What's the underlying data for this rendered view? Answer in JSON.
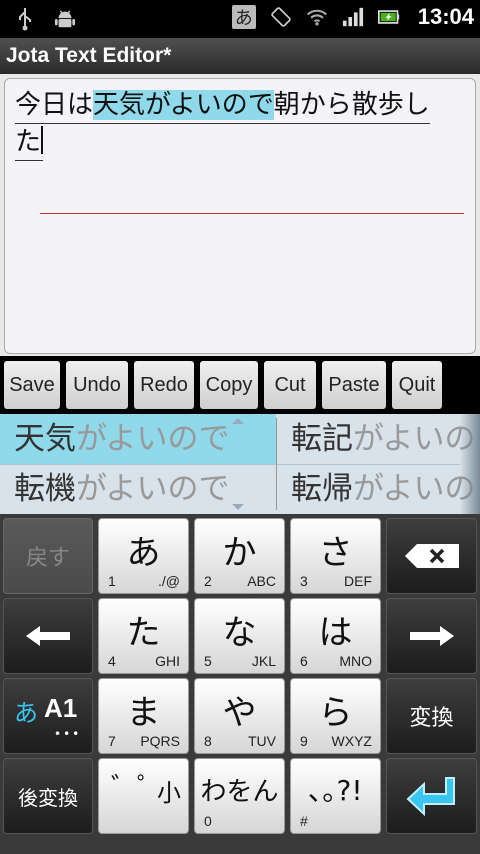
{
  "statusbar": {
    "ime_indicator": "あ",
    "time": "13:04",
    "icons": [
      "usb-icon",
      "android-debug-icon",
      "ime-icon",
      "rotation-icon",
      "wifi-icon",
      "signal-icon",
      "battery-icon"
    ]
  },
  "app": {
    "title": "Jota Text Editor*"
  },
  "editor": {
    "line1_before": "今日は",
    "line1_highlight": "天気がよいので",
    "line1_after": "朝から散歩し",
    "line2": "た"
  },
  "toolbar": {
    "save": "Save",
    "undo": "Undo",
    "redo": "Redo",
    "copy": "Copy",
    "cut": "Cut",
    "paste": "Paste",
    "quit": "Quit"
  },
  "candidates": [
    {
      "kanji": "天気",
      "kana": "がよいので"
    },
    {
      "kanji": "転記",
      "kana": "がよいので"
    },
    {
      "kanji": "転機",
      "kana": "がよいので"
    },
    {
      "kanji": "転帰",
      "kana": "がよいので"
    }
  ],
  "keyboard": {
    "back": "戻す",
    "key_a": {
      "main": "あ",
      "num": "1",
      "sub": "./@"
    },
    "key_ka": {
      "main": "か",
      "num": "2",
      "sub": "ABC"
    },
    "key_sa": {
      "main": "さ",
      "num": "3",
      "sub": "DEF"
    },
    "key_ta": {
      "main": "た",
      "num": "4",
      "sub": "GHI"
    },
    "key_na": {
      "main": "な",
      "num": "5",
      "sub": "JKL"
    },
    "key_ha": {
      "main": "は",
      "num": "6",
      "sub": "MNO"
    },
    "key_ma": {
      "main": "ま",
      "num": "7",
      "sub": "PQRS"
    },
    "key_ya": {
      "main": "や",
      "num": "8",
      "sub": "TUV"
    },
    "key_ra": {
      "main": "ら",
      "num": "9",
      "sub": "WXYZ"
    },
    "key_dakuten": {
      "main": "゛゜",
      "small": "小"
    },
    "key_wa": {
      "main": "わをん",
      "num": "0"
    },
    "key_punct": {
      "main": "､｡?!",
      "num": "#"
    },
    "mode": {
      "kana": "あ",
      "latin": "A1",
      "dots": "•••"
    },
    "convert": "変換",
    "reconvert": "後変換"
  },
  "colors": {
    "highlight": "#8fd9ea",
    "cursor_line": "#cc3333"
  }
}
